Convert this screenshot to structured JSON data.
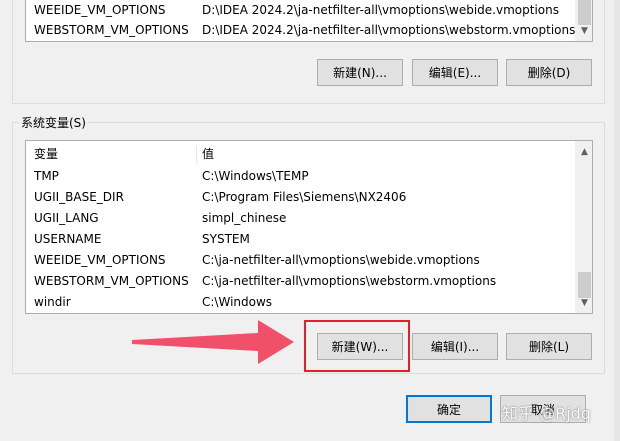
{
  "user_vars": {
    "rows": [
      {
        "name": "WEEIDE_VM_OPTIONS",
        "value": "D:\\IDEA 2024.2\\ja-netfilter-all\\vmoptions\\webide.vmoptions"
      },
      {
        "name": "WEBSTORM_VM_OPTIONS",
        "value": "D:\\IDEA 2024.2\\ja-netfilter-all\\vmoptions\\webstorm.vmoptions"
      }
    ],
    "buttons": {
      "new": "新建(N)...",
      "edit": "编辑(E)...",
      "delete": "删除(D)"
    }
  },
  "system_vars": {
    "group_label": "系统变量(S)",
    "header": {
      "name": "变量",
      "value": "值"
    },
    "rows": [
      {
        "name": "TMP",
        "value": "C:\\Windows\\TEMP"
      },
      {
        "name": "UGII_BASE_DIR",
        "value": "C:\\Program Files\\Siemens\\NX2406"
      },
      {
        "name": "UGII_LANG",
        "value": "simpl_chinese"
      },
      {
        "name": "USERNAME",
        "value": "SYSTEM"
      },
      {
        "name": "WEEIDE_VM_OPTIONS",
        "value": "C:\\ja-netfilter-all\\vmoptions\\webide.vmoptions"
      },
      {
        "name": "WEBSTORM_VM_OPTIONS",
        "value": "C:\\ja-netfilter-all\\vmoptions\\webstorm.vmoptions"
      },
      {
        "name": "windir",
        "value": "C:\\Windows"
      }
    ],
    "buttons": {
      "new": "新建(W)...",
      "edit": "编辑(I)...",
      "delete": "删除(L)"
    }
  },
  "dialog": {
    "ok": "确定",
    "cancel": "取消"
  },
  "annotations": {
    "arrow_color": "#f0506a",
    "highlight_color": "#e0202a"
  },
  "watermark": "知乎 @Rjdq",
  "icons": {
    "scroll_up": "▲",
    "scroll_down": "▼"
  }
}
